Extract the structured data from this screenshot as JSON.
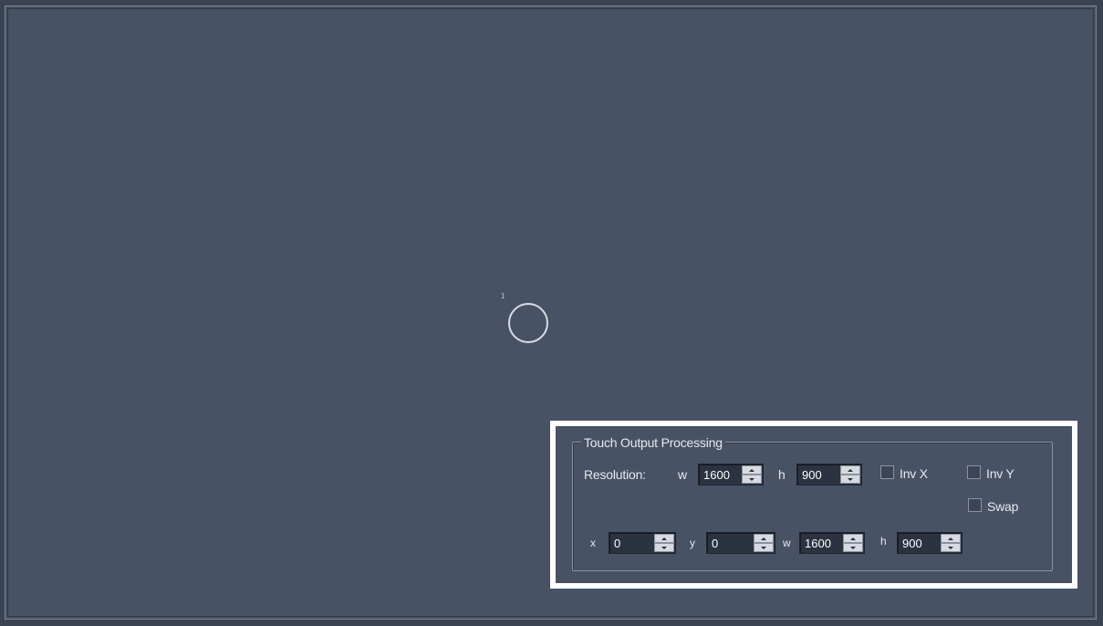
{
  "touch_view": {
    "touch_point_id": "1"
  },
  "panel": {
    "group_title": "Touch Output Processing",
    "resolution_label": "Resolution:",
    "res_w_label": "w",
    "res_w_value": "1600",
    "res_h_label": "h",
    "res_h_value": "900",
    "inv_x_label": "Inv X",
    "inv_y_label": "Inv Y",
    "swap_label": "Swap",
    "x_label": "x",
    "x_value": "0",
    "y_label": "y",
    "y_value": "0",
    "crop_w_label": "w",
    "crop_w_value": "1600",
    "crop_h_label": "h",
    "crop_h_value": "900",
    "inv_x_checked": false,
    "inv_y_checked": false,
    "swap_checked": false
  },
  "colors": {
    "background": "#475265",
    "highlight": "#ffffff"
  }
}
